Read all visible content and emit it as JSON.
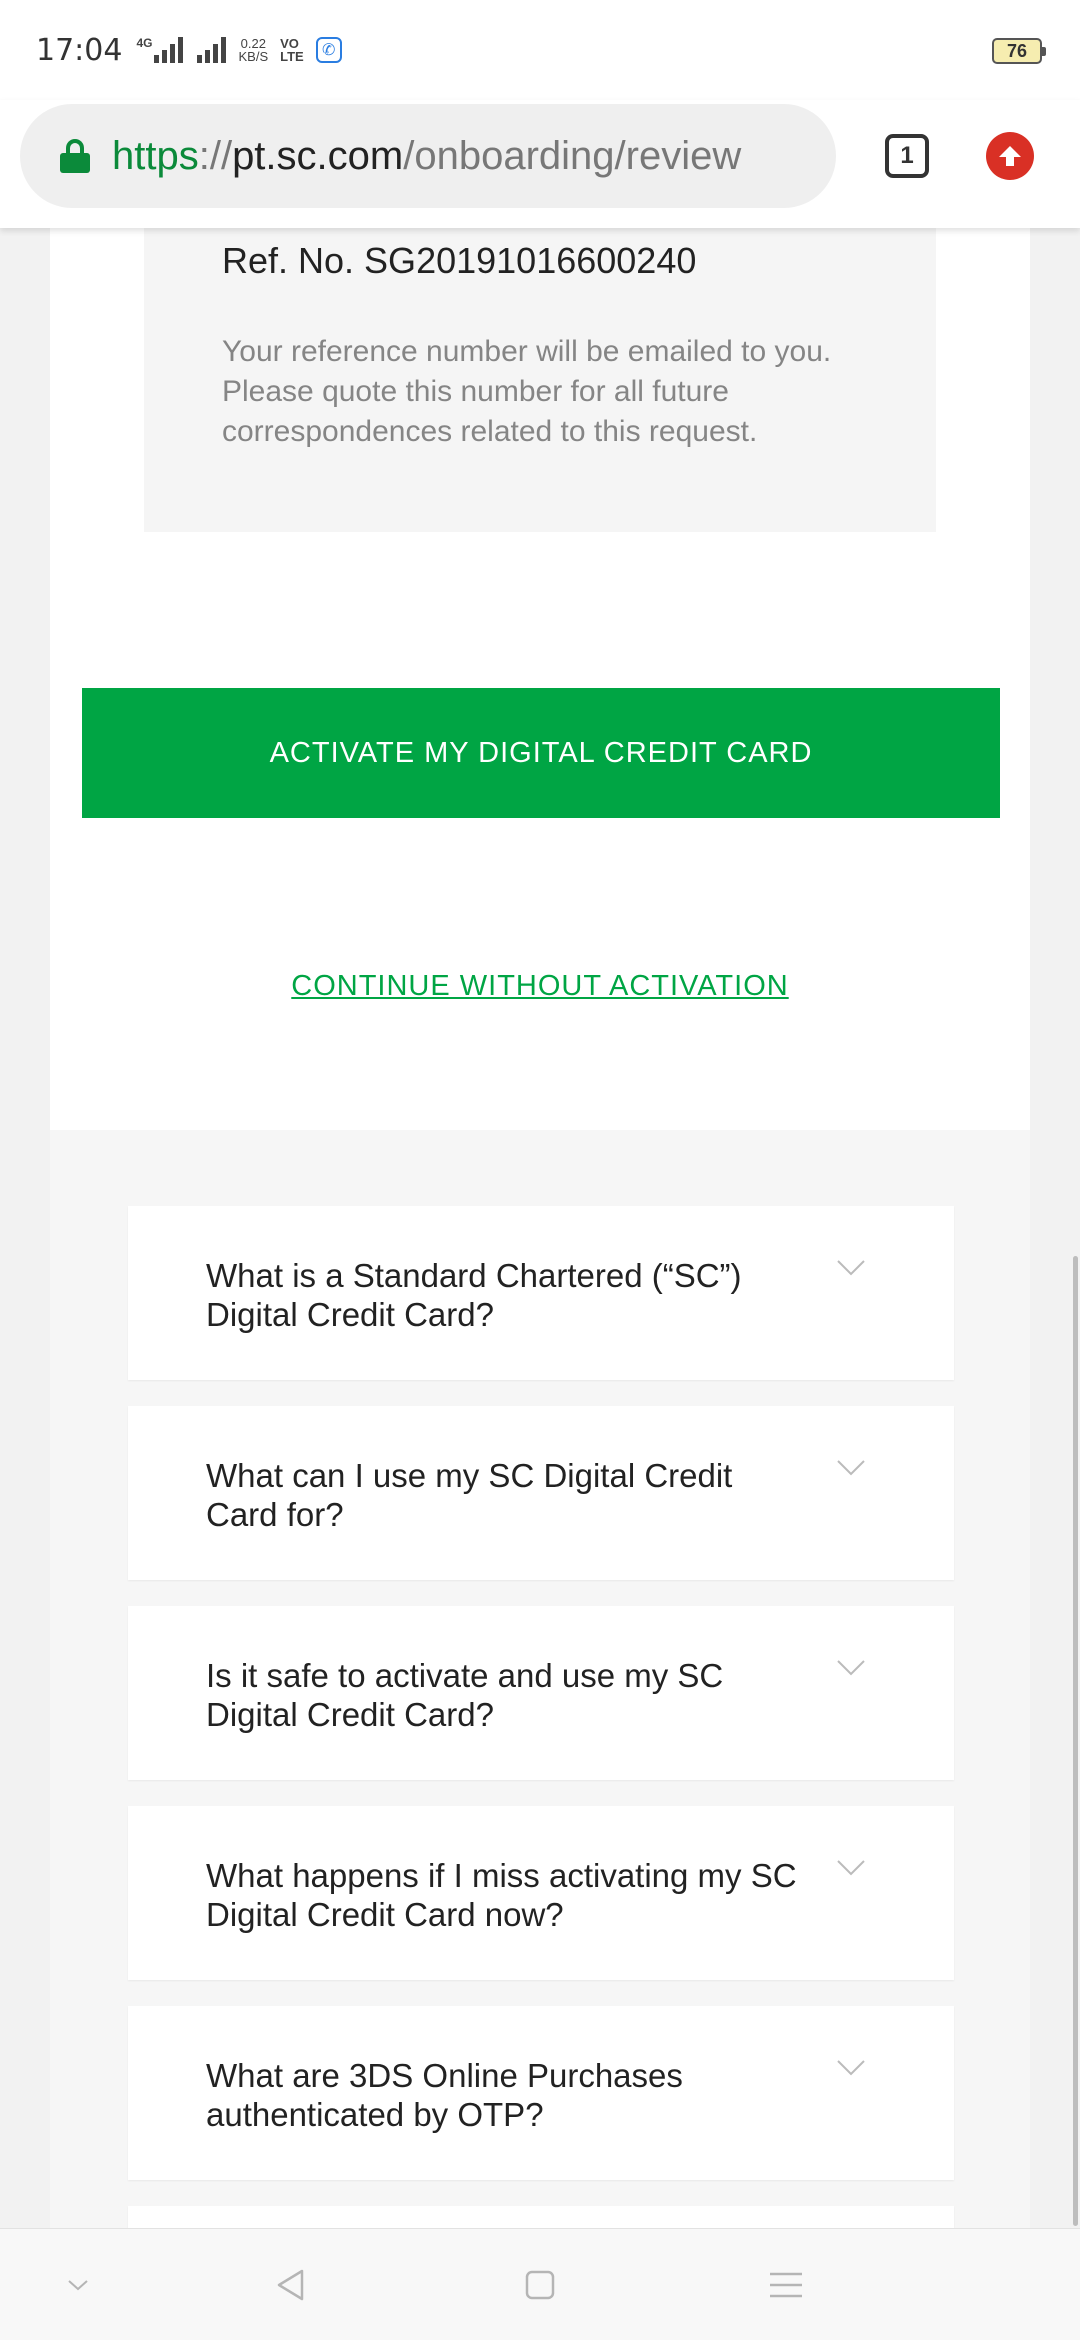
{
  "status_bar": {
    "time": "17:04",
    "network_label": "4G",
    "net_speed_value": "0.22",
    "net_speed_unit": "KB/S",
    "volte_top": "VO",
    "volte_bottom": "LTE",
    "battery": "76"
  },
  "browser": {
    "url_scheme": "https",
    "url_sep": "://",
    "url_host": "pt.sc.com",
    "url_path": "/onboarding/review",
    "tab_count": "1"
  },
  "confirmation": {
    "ref_number": "Ref. No. SG20191016600240",
    "ref_note": "Your reference number will be emailed to you. Please quote this number for all future correspondences related to this request."
  },
  "actions": {
    "activate_label": "ACTIVATE MY DIGITAL CREDIT CARD",
    "continue_label": "CONTINUE WITHOUT ACTIVATION"
  },
  "faq": [
    {
      "question": "What is a Standard Chartered (“SC”) Digital Credit Card?"
    },
    {
      "question": "What can I use my SC Digital Credit Card for?"
    },
    {
      "question": "Is it safe to activate and use my SC Digital Credit Card?"
    },
    {
      "question": "What happens if I miss activating my SC Digital Credit Card now?"
    },
    {
      "question": "What are 3DS Online Purchases authenticated by OTP?"
    }
  ],
  "colors": {
    "brand_green": "#00a544",
    "secure_green": "#0b8a3a",
    "update_red": "#d93025"
  },
  "icons": [
    "lock-icon",
    "tab-switcher-icon",
    "update-icon",
    "chevron-down-icon",
    "back-icon",
    "home-icon",
    "menu-icon"
  ]
}
